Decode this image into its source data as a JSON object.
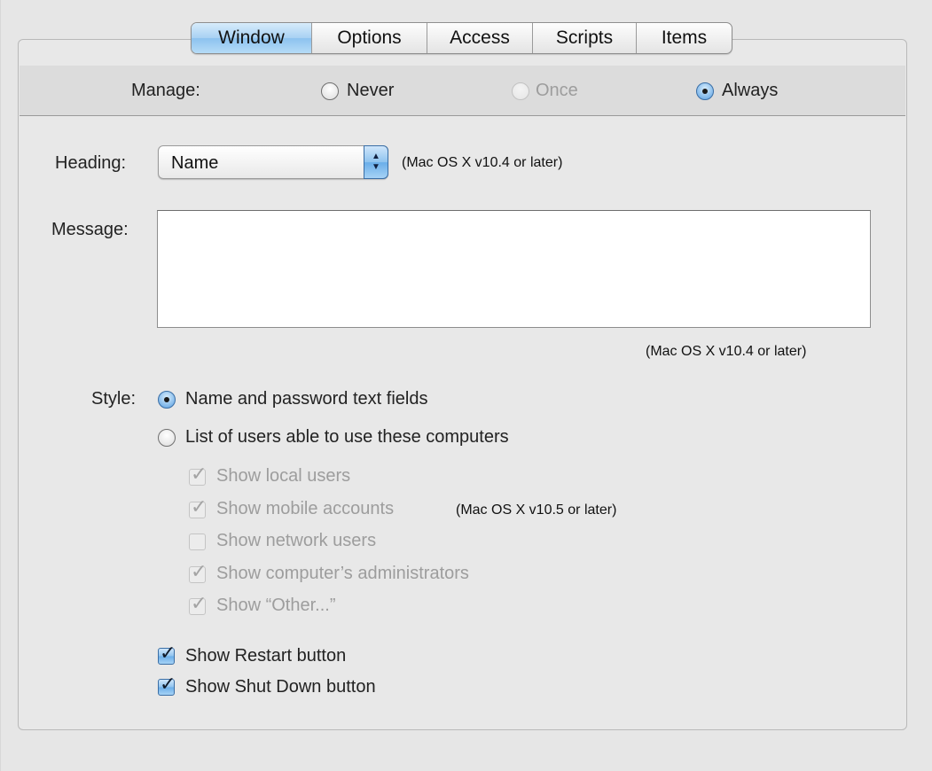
{
  "tabs": [
    {
      "label": "Window",
      "selected": true
    },
    {
      "label": "Options",
      "selected": false
    },
    {
      "label": "Access",
      "selected": false
    },
    {
      "label": "Scripts",
      "selected": false
    },
    {
      "label": "Items",
      "selected": false
    }
  ],
  "manage": {
    "label": "Manage:",
    "options": [
      {
        "label": "Never",
        "selected": false,
        "enabled": true
      },
      {
        "label": "Once",
        "selected": false,
        "enabled": false
      },
      {
        "label": "Always",
        "selected": true,
        "enabled": true
      }
    ]
  },
  "heading": {
    "label": "Heading:",
    "value": "Name",
    "note": "(Mac OS X v10.4 or later)"
  },
  "message": {
    "label": "Message:",
    "value": "",
    "note": "(Mac OS X v10.4 or later)"
  },
  "style": {
    "label": "Style:",
    "options": [
      {
        "label": "Name and password text fields",
        "selected": true
      },
      {
        "label": "List of users able to use these computers",
        "selected": false
      }
    ],
    "list_options": [
      {
        "label": "Show local users",
        "checked": true,
        "enabled": false
      },
      {
        "label": "Show mobile accounts",
        "checked": true,
        "enabled": false,
        "note": "(Mac OS X v10.5 or later)"
      },
      {
        "label": "Show network users",
        "checked": false,
        "enabled": false
      },
      {
        "label": "Show computer’s administrators",
        "checked": true,
        "enabled": false
      },
      {
        "label": "Show “Other...”",
        "checked": true,
        "enabled": false
      }
    ]
  },
  "buttons": [
    {
      "label": "Show Restart button",
      "checked": true
    },
    {
      "label": "Show Shut Down button",
      "checked": true
    }
  ],
  "icons": {
    "checkmark": "✓",
    "popup_arrows": "▲▼"
  },
  "colors": {
    "accent_blue": "#8cc2ef",
    "panel_bg": "#e8e8e8",
    "disabled_text": "#9d9d9d"
  }
}
